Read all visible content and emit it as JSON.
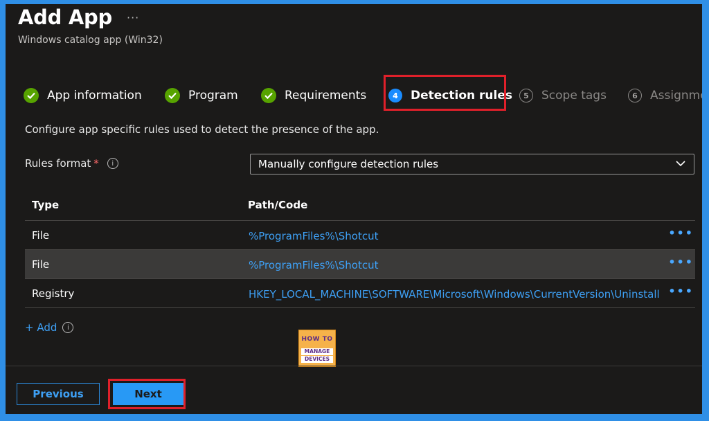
{
  "header": {
    "title": "Add App",
    "more": "···",
    "subtitle": "Windows catalog app (Win32)"
  },
  "steps": [
    {
      "label": "App information",
      "state": "complete"
    },
    {
      "label": "Program",
      "state": "complete"
    },
    {
      "label": "Requirements",
      "state": "complete"
    },
    {
      "label": "Detection rules",
      "state": "active",
      "number": "4"
    },
    {
      "label": "Scope tags",
      "state": "pending",
      "number": "5"
    },
    {
      "label": "Assignments",
      "state": "pending",
      "number": "6"
    }
  ],
  "description": "Configure app specific rules used to detect the presence of the app.",
  "rules_format": {
    "label": "Rules format",
    "required_mark": "*",
    "info_icon": "i",
    "selected": "Manually configure detection rules"
  },
  "table": {
    "headers": {
      "type": "Type",
      "path": "Path/Code"
    },
    "rows": [
      {
        "type": "File",
        "path": "%ProgramFiles%\\Shotcut",
        "more": "•••"
      },
      {
        "type": "File",
        "path": "%ProgramFiles%\\Shotcut",
        "more": "•••"
      },
      {
        "type": "Registry",
        "path": "HKEY_LOCAL_MACHINE\\SOFTWARE\\Microsoft\\Windows\\CurrentVersion\\Uninstall",
        "more": "•••"
      }
    ]
  },
  "add_link": {
    "label": "+ Add",
    "info_icon": "i"
  },
  "logo": {
    "line1": "HOW TO",
    "line2": "MANAGE",
    "line3": "DEVICES"
  },
  "footer": {
    "previous_label": "Previous",
    "next_label": "Next"
  },
  "colors": {
    "accent": "#2899f5",
    "complete": "#57a300",
    "highlight": "#e0202a",
    "link": "#3ea0f5",
    "background": "#1b1a19",
    "border": "#2f8fe6"
  }
}
